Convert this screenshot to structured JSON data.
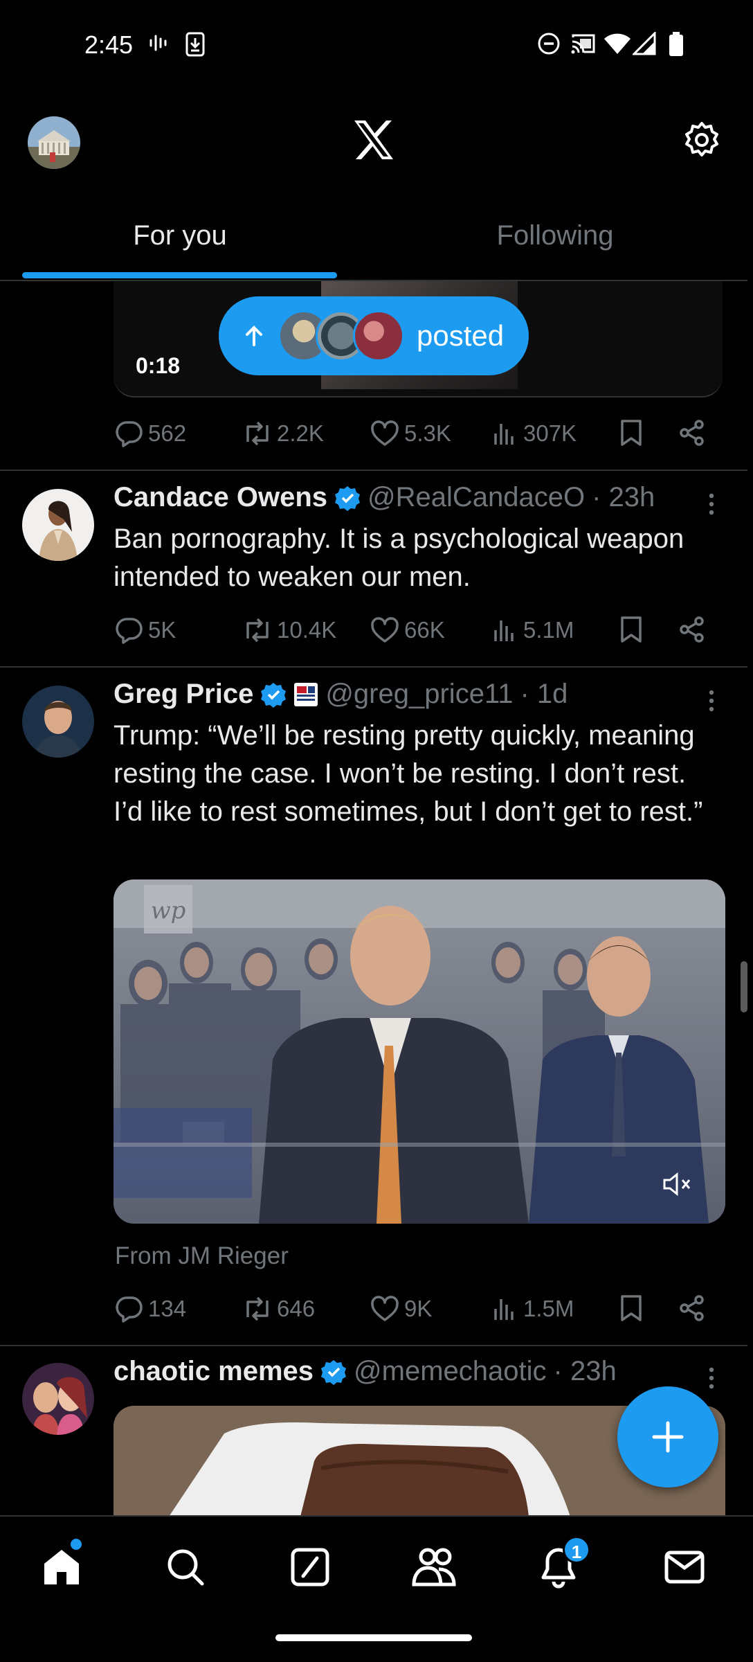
{
  "status_bar": {
    "time": "2:45",
    "icons": [
      "voicemail-icon",
      "download-icon",
      "dnd-icon",
      "cast-icon",
      "wifi-icon",
      "signal-icon",
      "battery-icon"
    ]
  },
  "header": {
    "logo": "X",
    "tabs": [
      {
        "label": "For you",
        "active": true
      },
      {
        "label": "Following",
        "active": false
      }
    ]
  },
  "new_posts_pill": {
    "label": "posted"
  },
  "tweets": [
    {
      "partial": true,
      "video_duration": "0:18",
      "stats": {
        "replies": "562",
        "reposts": "2.2K",
        "likes": "5.3K",
        "views": "307K"
      }
    },
    {
      "name": "Candace Owens",
      "verified": true,
      "handle": "@RealCandaceO",
      "time": "· 23h",
      "text": "Ban pornography. It is a psychological weapon intended to weaken our men.",
      "stats": {
        "replies": "5K",
        "reposts": "10.4K",
        "likes": "66K",
        "views": "5.1M"
      }
    },
    {
      "name": "Greg Price",
      "verified": true,
      "handle": "@greg_price11",
      "time": "· 1d",
      "text": "Trump: “We’ll be resting pretty quickly, meaning resting the case. I won’t be resting. I don’t rest. I’d like to rest sometimes, but I don’t get to rest.”",
      "media_watermark": "wp",
      "source": "From JM Rieger",
      "stats": {
        "replies": "134",
        "reposts": "646",
        "likes": "9K",
        "views": "1.5M"
      }
    },
    {
      "name": "chaotic memes",
      "verified": true,
      "handle": "@memechaotic",
      "time": "· 23h"
    }
  ],
  "bottom_nav": {
    "items": [
      "home-icon",
      "search-icon",
      "grok-icon",
      "communities-icon",
      "notifications-icon",
      "messages-icon"
    ],
    "notification_count": "1"
  },
  "colors": {
    "accent": "#1d9bf0",
    "background": "#000000",
    "text_primary": "#e7e9ea",
    "text_secondary": "#71767b",
    "divider": "#2f3336"
  }
}
